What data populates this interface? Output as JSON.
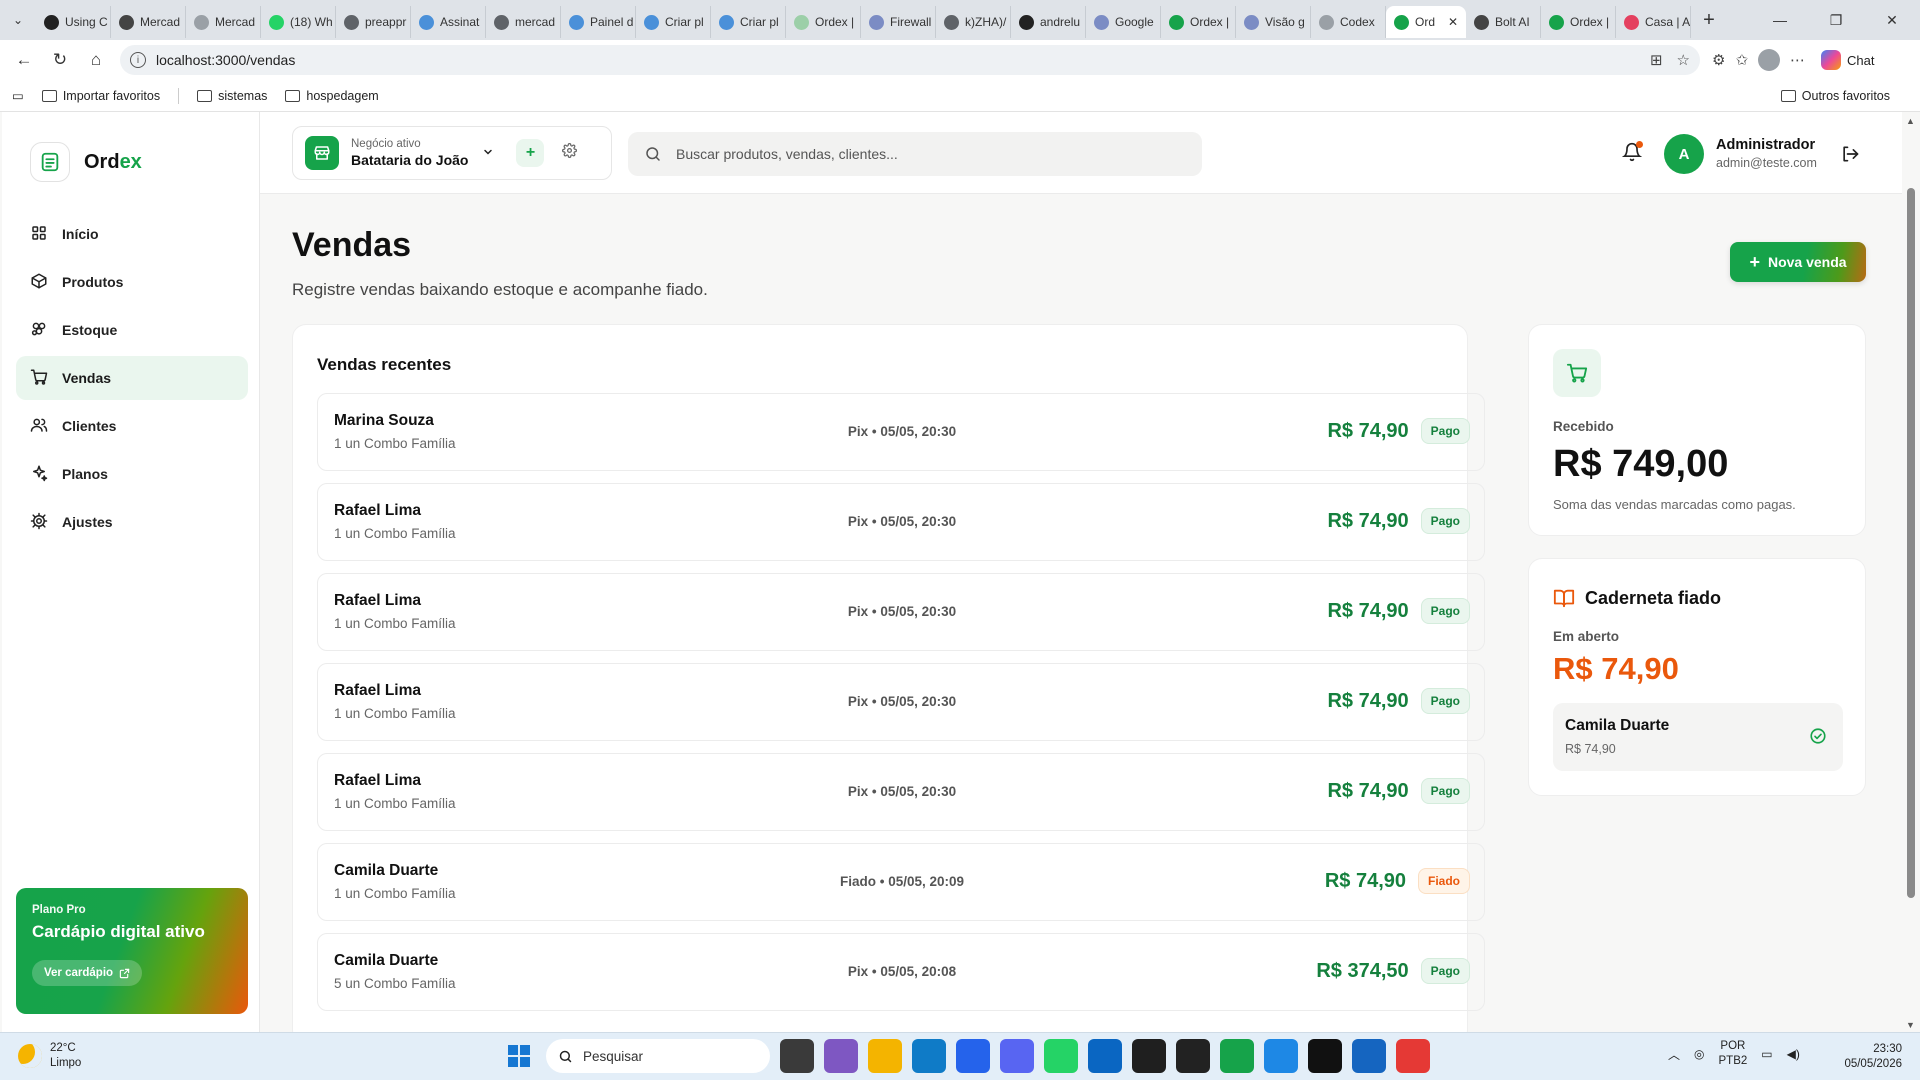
{
  "browser": {
    "tabs": [
      {
        "label": "Using C",
        "color": "#222222"
      },
      {
        "label": "Mercad",
        "color": "#444444"
      },
      {
        "label": "Mercad",
        "color": "#9aa0a6"
      },
      {
        "label": "(18) Wh",
        "color": "#25d366"
      },
      {
        "label": "preappr",
        "color": "#5f6368"
      },
      {
        "label": "Assinat",
        "color": "#4a90d9"
      },
      {
        "label": "mercad",
        "color": "#5f6368"
      },
      {
        "label": "Painel d",
        "color": "#4a90d9"
      },
      {
        "label": "Criar pl",
        "color": "#4a90d9"
      },
      {
        "label": "Criar pl",
        "color": "#4a90d9"
      },
      {
        "label": "Ordex |",
        "color": "#9ccfa8"
      },
      {
        "label": "Firewall",
        "color": "#7b8cc4"
      },
      {
        "label": "k)ZHA)/",
        "color": "#5f6368"
      },
      {
        "label": "andrelu",
        "color": "#222222"
      },
      {
        "label": "Google",
        "color": "#7b8cc4"
      },
      {
        "label": "Ordex |",
        "color": "#16a34a"
      },
      {
        "label": "Visão g",
        "color": "#7b8cc4"
      },
      {
        "label": "Codex",
        "color": "#9aa0a6"
      },
      {
        "label": "Ord",
        "color": "#16a34a",
        "active": true
      },
      {
        "label": "Bolt AI",
        "color": "#444444"
      },
      {
        "label": "Ordex |",
        "color": "#16a34a"
      },
      {
        "label": "Casa | A",
        "color": "#e4405f"
      }
    ],
    "url": "localhost:3000/vendas",
    "chat_label": "Chat",
    "bookmarks": {
      "import": "Importar favoritos",
      "folder1": "sistemas",
      "folder2": "hospedagem",
      "others": "Outros favoritos"
    }
  },
  "app": {
    "brand": {
      "prefix": "Ord",
      "suffix": "ex"
    },
    "nav": [
      {
        "label": "Início",
        "icon": "grid-icon",
        "active": false
      },
      {
        "label": "Produtos",
        "icon": "box-icon",
        "active": false
      },
      {
        "label": "Estoque",
        "icon": "layers-icon",
        "active": false
      },
      {
        "label": "Vendas",
        "icon": "cart-icon",
        "active": true
      },
      {
        "label": "Clientes",
        "icon": "users-icon",
        "active": false
      },
      {
        "label": "Planos",
        "icon": "sparkles-icon",
        "active": false
      },
      {
        "label": "Ajustes",
        "icon": "gear-icon",
        "active": false
      }
    ],
    "promo": {
      "kicker": "Plano Pro",
      "title": "Cardápio digital ativo",
      "button": "Ver cardápio"
    },
    "business": {
      "label": "Negócio ativo",
      "name": "Batataria do João"
    },
    "search": {
      "placeholder": "Buscar produtos, vendas, clientes..."
    },
    "user": {
      "initial": "A",
      "name": "Administrador",
      "email": "admin@teste.com"
    },
    "accent": "#16a34a",
    "warning": "#ea580c"
  },
  "page": {
    "title": "Vendas",
    "subtitle": "Registre vendas baixando estoque e acompanhe fiado.",
    "new_sale": "Nova venda"
  },
  "sales": {
    "title": "Vendas recentes",
    "rows": [
      {
        "name": "Marina Souza",
        "items": "1 un Combo Família",
        "meta": "Pix • 05/05, 20:30",
        "amount": "R$ 74,90",
        "status": "Pago",
        "kind": "pago"
      },
      {
        "name": "Rafael Lima",
        "items": "1 un Combo Família",
        "meta": "Pix • 05/05, 20:30",
        "amount": "R$ 74,90",
        "status": "Pago",
        "kind": "pago"
      },
      {
        "name": "Rafael Lima",
        "items": "1 un Combo Família",
        "meta": "Pix • 05/05, 20:30",
        "amount": "R$ 74,90",
        "status": "Pago",
        "kind": "pago"
      },
      {
        "name": "Rafael Lima",
        "items": "1 un Combo Família",
        "meta": "Pix • 05/05, 20:30",
        "amount": "R$ 74,90",
        "status": "Pago",
        "kind": "pago"
      },
      {
        "name": "Rafael Lima",
        "items": "1 un Combo Família",
        "meta": "Pix • 05/05, 20:30",
        "amount": "R$ 74,90",
        "status": "Pago",
        "kind": "pago"
      },
      {
        "name": "Camila Duarte",
        "items": "1 un Combo Família",
        "meta": "Fiado • 05/05, 20:09",
        "amount": "R$ 74,90",
        "status": "Fiado",
        "kind": "fiado"
      },
      {
        "name": "Camila Duarte",
        "items": "5 un Combo Família",
        "meta": "Pix • 05/05, 20:08",
        "amount": "R$ 374,50",
        "status": "Pago",
        "kind": "pago"
      }
    ]
  },
  "received": {
    "label": "Recebido",
    "value": "R$ 749,00",
    "note": "Soma das vendas marcadas como pagas."
  },
  "fiado": {
    "title": "Caderneta fiado",
    "label": "Em aberto",
    "value": "R$ 74,90",
    "debtor": {
      "name": "Camila Duarte",
      "amount": "R$ 74,90"
    }
  },
  "taskbar": {
    "weather_temp": "22°C",
    "weather_desc": "Limpo",
    "search": "Pesquisar",
    "lang1": "POR",
    "lang2": "PTB2",
    "time": "23:30",
    "date": "05/05/2026"
  }
}
